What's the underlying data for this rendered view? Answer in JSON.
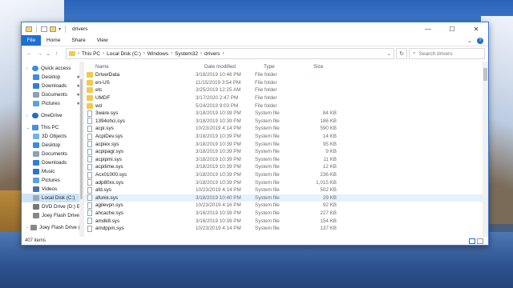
{
  "window": {
    "title": "drivers"
  },
  "ribbon": {
    "file": "File",
    "tabs": [
      "Home",
      "Share",
      "View"
    ]
  },
  "address": {
    "crumbs": [
      "This PC",
      "Local Disk (C:)",
      "Windows",
      "System32",
      "drivers"
    ],
    "search_placeholder": "Search drivers"
  },
  "nav": {
    "quick_access": "Quick access",
    "quick_items": [
      "Desktop",
      "Downloads",
      "Documents",
      "Pictures"
    ],
    "onedrive": "OneDrive",
    "this_pc": "This PC",
    "pc_items": [
      "3D Objects",
      "Desktop",
      "Documents",
      "Downloads",
      "Music",
      "Pictures",
      "Videos",
      "Local Disk (C:)",
      "DVD Drive (D:) E!",
      "Joey Flash Drive"
    ],
    "flash": "Joey Flash Drive (E"
  },
  "columns": {
    "name": "Name",
    "date": "Date modified",
    "type": "Type",
    "size": "Size"
  },
  "files": [
    {
      "name": "DriverData",
      "date": "3/18/2019 10:46 PM",
      "type": "File folder",
      "size": "",
      "kind": "folder"
    },
    {
      "name": "en-US",
      "date": "11/15/2019 3:54 PM",
      "type": "File folder",
      "size": "",
      "kind": "folder"
    },
    {
      "name": "etc",
      "date": "3/25/2019 12:25 AM",
      "type": "File folder",
      "size": "",
      "kind": "folder"
    },
    {
      "name": "UMDF",
      "date": "3/17/2020 2:47 PM",
      "type": "File folder",
      "size": "",
      "kind": "folder"
    },
    {
      "name": "wd",
      "date": "5/24/2019 9:03 PM",
      "type": "File folder",
      "size": "",
      "kind": "folder"
    },
    {
      "name": "3ware.sys",
      "date": "3/18/2019 10:39 PM",
      "type": "System file",
      "size": "84 KB",
      "kind": "file"
    },
    {
      "name": "1394ohci.sys",
      "date": "3/18/2019 10:39 PM",
      "type": "System file",
      "size": "186 KB",
      "kind": "file"
    },
    {
      "name": "acpi.sys",
      "date": "10/23/2019 4:14 PM",
      "type": "System file",
      "size": "590 KB",
      "kind": "file"
    },
    {
      "name": "AcpiDev.sys",
      "date": "3/18/2019 10:39 PM",
      "type": "System file",
      "size": "14 KB",
      "kind": "file"
    },
    {
      "name": "acpiex.sys",
      "date": "3/18/2019 10:39 PM",
      "type": "System file",
      "size": "95 KB",
      "kind": "file"
    },
    {
      "name": "acpipagr.sys",
      "date": "3/18/2019 10:39 PM",
      "type": "System file",
      "size": "9 KB",
      "kind": "file"
    },
    {
      "name": "acpipmi.sys",
      "date": "3/18/2019 10:39 PM",
      "type": "System file",
      "size": "11 KB",
      "kind": "file"
    },
    {
      "name": "acpitime.sys",
      "date": "3/18/2019 10:39 PM",
      "type": "System file",
      "size": "12 KB",
      "kind": "file"
    },
    {
      "name": "Acx01000.sys",
      "date": "3/18/2019 10:39 PM",
      "type": "System file",
      "size": "236 KB",
      "kind": "file"
    },
    {
      "name": "adp80xx.sys",
      "date": "3/18/2019 10:39 PM",
      "type": "System file",
      "size": "1,015 KB",
      "kind": "file"
    },
    {
      "name": "afd.sys",
      "date": "10/23/2019 4:14 PM",
      "type": "System file",
      "size": "502 KB",
      "kind": "file"
    },
    {
      "name": "afunix.sys",
      "date": "3/18/2019 10:40 PM",
      "type": "System file",
      "size": "29 KB",
      "kind": "file"
    },
    {
      "name": "agilevpn.sys",
      "date": "10/23/2019 4:16 PM",
      "type": "System file",
      "size": "92 KB",
      "kind": "file"
    },
    {
      "name": "ahcache.sys",
      "date": "3/18/2019 10:39 PM",
      "type": "System file",
      "size": "227 KB",
      "kind": "file"
    },
    {
      "name": "amdk8.sys",
      "date": "3/18/2019 10:39 PM",
      "type": "System file",
      "size": "154 KB",
      "kind": "file"
    },
    {
      "name": "amdppm.sys",
      "date": "10/23/2019 4:14 PM",
      "type": "System file",
      "size": "137 KB",
      "kind": "file"
    }
  ],
  "status": {
    "count": "407 items"
  },
  "colors": {
    "accent": "#1e6fcf",
    "folder": "#f3c94d",
    "selected": "#cce4f7"
  }
}
